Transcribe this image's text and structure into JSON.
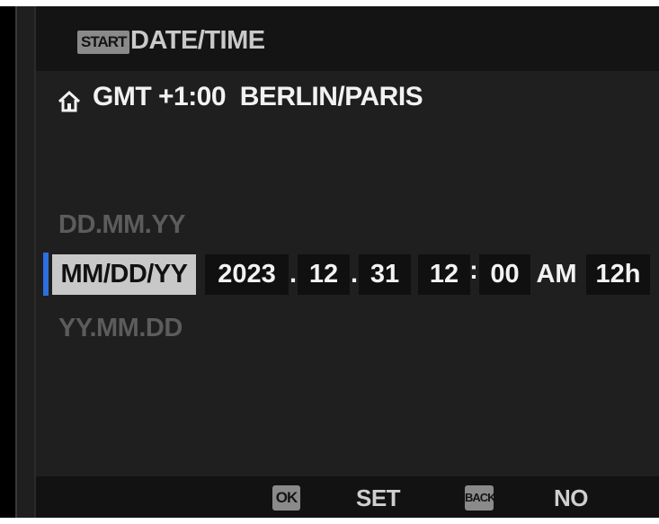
{
  "header": {
    "start_badge": "START",
    "title": "DATE/TIME"
  },
  "timezone": {
    "icon": "home-icon",
    "text": "GMT +1:00  BERLIN/PARIS"
  },
  "date_formats": {
    "options": [
      "DD.MM.YY",
      "MM/DD/YY",
      "YY.MM.DD"
    ],
    "selected": "MM/DD/YY"
  },
  "datetime": {
    "year": "2023",
    "month": "12",
    "day": "31",
    "date_separator": ".",
    "hour": "12",
    "time_separator": ":",
    "minute": "00",
    "ampm": "AM",
    "clock_mode": "12h"
  },
  "footer": {
    "ok_badge": "OK",
    "ok_label": "SET",
    "back_badge": "BACK",
    "back_label": "NO"
  },
  "colors": {
    "background": "#1f1f1f",
    "selection_accent": "#2d6fe0",
    "selected_box": "#c8c8c8"
  }
}
